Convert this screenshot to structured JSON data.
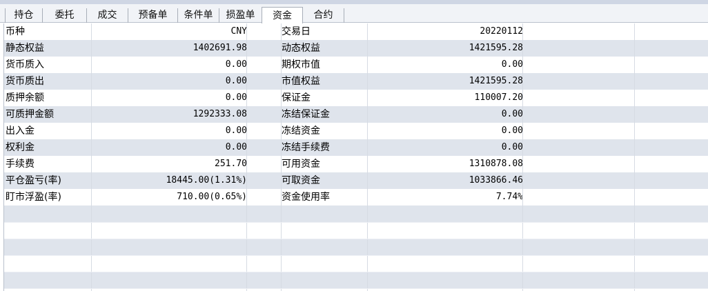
{
  "tabs": [
    {
      "label": "持仓",
      "active": false
    },
    {
      "label": "委托",
      "active": false
    },
    {
      "label": "成交",
      "active": false
    },
    {
      "label": "预备单",
      "active": false
    },
    {
      "label": "条件单",
      "active": false
    },
    {
      "label": "损盈单",
      "active": false
    },
    {
      "label": "资金",
      "active": true
    },
    {
      "label": "合约",
      "active": false
    }
  ],
  "fund_rows": [
    {
      "label1": "币种",
      "value1": "CNY",
      "label2": "交易日",
      "value2": "20220112"
    },
    {
      "label1": "静态权益",
      "value1": "1402691.98",
      "label2": "动态权益",
      "value2": "1421595.28"
    },
    {
      "label1": "货币质入",
      "value1": "0.00",
      "label2": "期权市值",
      "value2": "0.00"
    },
    {
      "label1": "货币质出",
      "value1": "0.00",
      "label2": "市值权益",
      "value2": "1421595.28"
    },
    {
      "label1": "质押余额",
      "value1": "0.00",
      "label2": "保证金",
      "value2": "110007.20"
    },
    {
      "label1": "可质押金额",
      "value1": "1292333.08",
      "label2": "冻结保证金",
      "value2": "0.00"
    },
    {
      "label1": "出入金",
      "value1": "0.00",
      "label2": "冻结资金",
      "value2": "0.00"
    },
    {
      "label1": "权利金",
      "value1": "0.00",
      "label2": "冻结手续费",
      "value2": "0.00"
    },
    {
      "label1": "手续费",
      "value1": "251.70",
      "label2": "可用资金",
      "value2": "1310878.08"
    },
    {
      "label1": "平仓盈亏(率)",
      "value1": "18445.00(1.31%)",
      "label2": "可取资金",
      "value2": "1033866.46"
    },
    {
      "label1": "盯市浮盈(率)",
      "value1": "710.00(0.65%)",
      "label2": "资金使用率",
      "value2": "7.74%"
    }
  ],
  "colors": {
    "alt_row": "#dfe4ec",
    "tab_bar": "#f1f3f7",
    "top_band": "#cfd6e4"
  }
}
